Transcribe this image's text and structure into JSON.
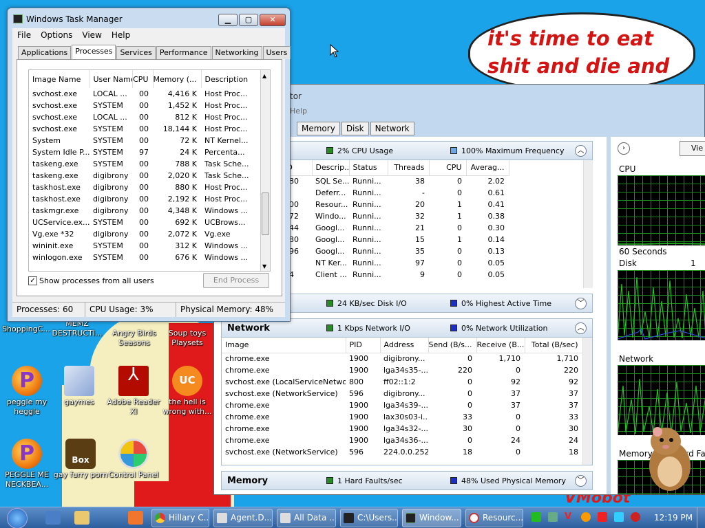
{
  "desktop": {
    "bubble_text": "it's time to eat shit and die and chew",
    "watermark": "VMobot",
    "icons": [
      {
        "label": "ShoppingC...",
        "icon": "shopping-icon"
      },
      {
        "label": "MEMZ DESTRUCTI...",
        "icon": "memz-icon"
      },
      {
        "label": "Angry Birds Seasons",
        "icon": "angry-birds-icon"
      },
      {
        "label": "Soup toys Playsets",
        "icon": "souptoys-icon"
      },
      {
        "label": "peggle my heggle",
        "icon": "peggle-icon"
      },
      {
        "label": "gaymes",
        "icon": "games-folder-icon"
      },
      {
        "label": "Adobe Reader XI",
        "icon": "adobe-reader-icon"
      },
      {
        "label": "the hell is wrong with...",
        "icon": "uc-browser-icon"
      },
      {
        "label": "PEGGLE ME NECKBEA...",
        "icon": "peggle-icon"
      },
      {
        "label": "gay furry porn",
        "icon": "box-icon"
      },
      {
        "label": "Control Panel",
        "icon": "control-panel-icon"
      }
    ]
  },
  "task_manager": {
    "title": "Windows Task Manager",
    "menu": [
      "File",
      "Options",
      "View",
      "Help"
    ],
    "tabs": [
      "Applications",
      "Processes",
      "Services",
      "Performance",
      "Networking",
      "Users"
    ],
    "active_tab": "Processes",
    "columns": [
      "Image Name",
      "User Name",
      "CPU",
      "Memory (...",
      "Description"
    ],
    "rows": [
      [
        "svchost.exe",
        "LOCAL ...",
        "00",
        "4,416 K",
        "Host Proc..."
      ],
      [
        "svchost.exe",
        "SYSTEM",
        "00",
        "1,452 K",
        "Host Proc..."
      ],
      [
        "svchost.exe",
        "LOCAL ...",
        "00",
        "812 K",
        "Host Proc..."
      ],
      [
        "svchost.exe",
        "SYSTEM",
        "00",
        "18,144 K",
        "Host Proc..."
      ],
      [
        "System",
        "SYSTEM",
        "00",
        "72 K",
        "NT Kernel..."
      ],
      [
        "System Idle P...",
        "SYSTEM",
        "97",
        "24 K",
        "Percenta..."
      ],
      [
        "taskeng.exe",
        "SYSTEM",
        "00",
        "788 K",
        "Task Sche..."
      ],
      [
        "taskeng.exe",
        "digibrony",
        "00",
        "2,020 K",
        "Task Sche..."
      ],
      [
        "taskhost.exe",
        "digibrony",
        "00",
        "880 K",
        "Host Proc..."
      ],
      [
        "taskhost.exe",
        "digibrony",
        "00",
        "2,192 K",
        "Host Proc..."
      ],
      [
        "taskmgr.exe",
        "digibrony",
        "00",
        "4,348 K",
        "Windows ..."
      ],
      [
        "UCService.ex...",
        "SYSTEM",
        "00",
        "692 K",
        "UCBrows..."
      ],
      [
        "Vg.exe *32",
        "digibrony",
        "00",
        "2,072 K",
        "Vg.exe"
      ],
      [
        "wininit.exe",
        "SYSTEM",
        "00",
        "312 K",
        "Windows ..."
      ],
      [
        "winlogon.exe",
        "SYSTEM",
        "00",
        "676 K",
        "Windows ..."
      ]
    ],
    "show_all_label": "Show processes from all users",
    "show_all_checked": true,
    "end_process_label": "End Process",
    "status": {
      "processes": "Processes: 60",
      "cpu": "CPU Usage: 3%",
      "memory": "Physical Memory: 48%"
    }
  },
  "resource_monitor": {
    "title_partial": "tor",
    "menu_partial": "Help",
    "tabs": [
      "Memory",
      "Disk",
      "Network"
    ],
    "cpu_section": {
      "indicator1": "2% CPU Usage",
      "indicator2": "100% Maximum Frequency",
      "columns": [
        "PID",
        "Descrip...",
        "Status",
        "Threads",
        "CPU",
        "Averag..."
      ],
      "rows": [
        [
          "1580",
          "SQL Se...",
          "Runni...",
          "38",
          "0",
          "2.02"
        ],
        [
          "-",
          "Deferr...",
          "Runni...",
          "-",
          "0",
          "0.61"
        ],
        [
          "4300",
          "Resour...",
          "Runni...",
          "20",
          "1",
          "0.41"
        ],
        [
          "1372",
          "Windo...",
          "Runni...",
          "32",
          "1",
          "0.38"
        ],
        [
          "2444",
          "Googl...",
          "Runni...",
          "21",
          "0",
          "0.30"
        ],
        [
          "2280",
          "Googl...",
          "Runni...",
          "15",
          "1",
          "0.14"
        ],
        [
          "6496",
          "Googl...",
          "Runni...",
          "35",
          "0",
          "0.13"
        ],
        [
          "4",
          "NT Ker...",
          "Runni...",
          "97",
          "0",
          "0.05"
        ],
        [
          "424",
          "Client ...",
          "Runni...",
          "9",
          "0",
          "0.05"
        ]
      ],
      "partial_text": "ts"
    },
    "disk_section": {
      "indicator1": "24 KB/sec Disk I/O",
      "indicator2": "0% Highest Active Time"
    },
    "network_section": {
      "name": "Network",
      "indicator1": "1 Kbps Network I/O",
      "indicator2": "0% Network Utilization",
      "columns": [
        "Image",
        "PID",
        "Address",
        "Send (B/s...",
        "Receive (B...",
        "Total (B/sec)"
      ],
      "rows": [
        [
          "chrome.exe",
          "1900",
          "digibrony...",
          "0",
          "1,710",
          "1,710"
        ],
        [
          "chrome.exe",
          "1900",
          "lga34s35-...",
          "220",
          "0",
          "220"
        ],
        [
          "svchost.exe (LocalServiceNetwo...",
          "800",
          "ff02::1:2",
          "0",
          "92",
          "92"
        ],
        [
          "svchost.exe (NetworkService)",
          "596",
          "digibrony...",
          "0",
          "37",
          "37"
        ],
        [
          "chrome.exe",
          "1900",
          "lga34s39-...",
          "0",
          "37",
          "37"
        ],
        [
          "chrome.exe",
          "1900",
          "lax30s03-i...",
          "33",
          "0",
          "33"
        ],
        [
          "chrome.exe",
          "1900",
          "lga34s32-...",
          "30",
          "0",
          "30"
        ],
        [
          "chrome.exe",
          "1900",
          "lga34s36-...",
          "0",
          "24",
          "24"
        ],
        [
          "svchost.exe (NetworkService)",
          "596",
          "224.0.0.252",
          "18",
          "0",
          "18"
        ]
      ]
    },
    "memory_section": {
      "name": "Memory",
      "indicator1": "1 Hard Faults/sec",
      "indicator2": "48% Used Physical Memory"
    },
    "graphs": {
      "view_label": "Vie",
      "cpu_label": "CPU",
      "seconds_label": "60 Seconds",
      "disk_label": "Disk",
      "disk_value": "1",
      "network_label": "Network",
      "memory_label": "Memory",
      "memory_value": "Hard Fa"
    }
  },
  "taskbar": {
    "buttons": [
      "Hillary C...",
      "Agent.D...",
      "All Data ...",
      "C:\\Users...",
      "Window...",
      "Resourc..."
    ],
    "clock": "12:19 PM"
  },
  "colors": {
    "desktop": "#1aa3e8",
    "bubble_text": "#d41313",
    "graph_line": "#22c322"
  }
}
